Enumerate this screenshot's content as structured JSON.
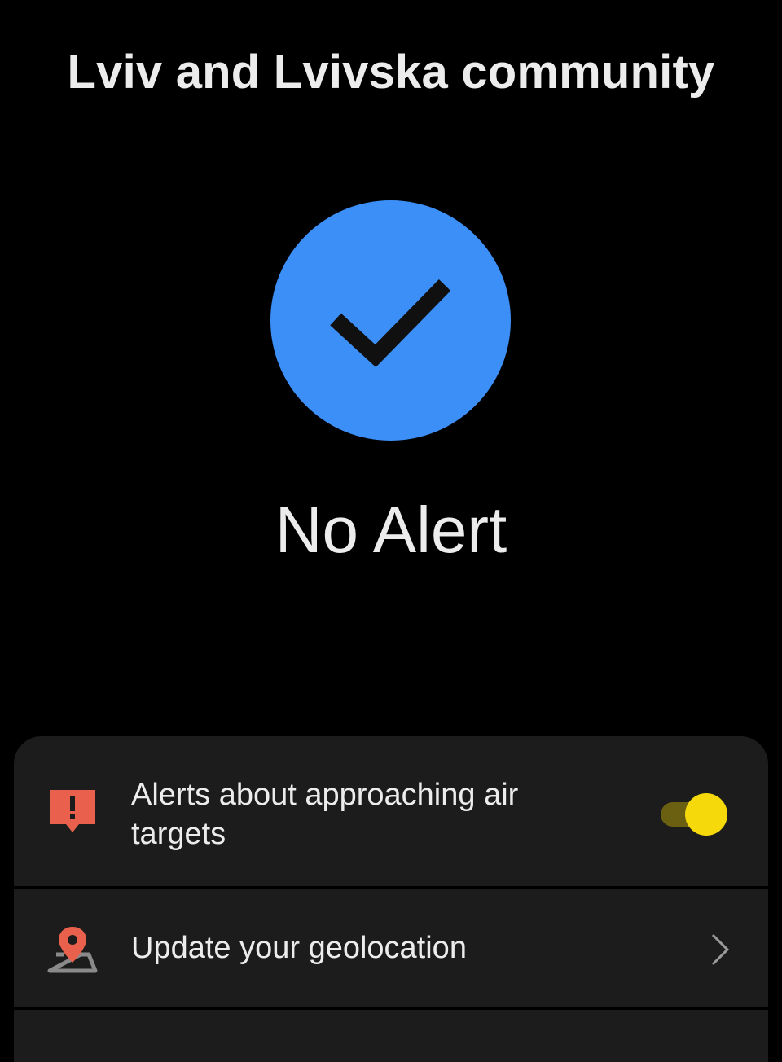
{
  "header": {
    "title": "Lviv and Lvivska community"
  },
  "status": {
    "icon": "checkmark-icon",
    "label": "No Alert",
    "color": "#3d8ff8"
  },
  "settings": {
    "items": [
      {
        "icon": "alert-message-icon",
        "icon_color": "#e9614c",
        "label": "Alerts about approaching air targets",
        "toggle_on": true,
        "toggle_color": "#f5d90a"
      },
      {
        "icon": "map-pin-icon",
        "icon_color": "#e9614c",
        "label": "Update your geolocation",
        "trailing": "chevron-right-icon"
      }
    ]
  }
}
